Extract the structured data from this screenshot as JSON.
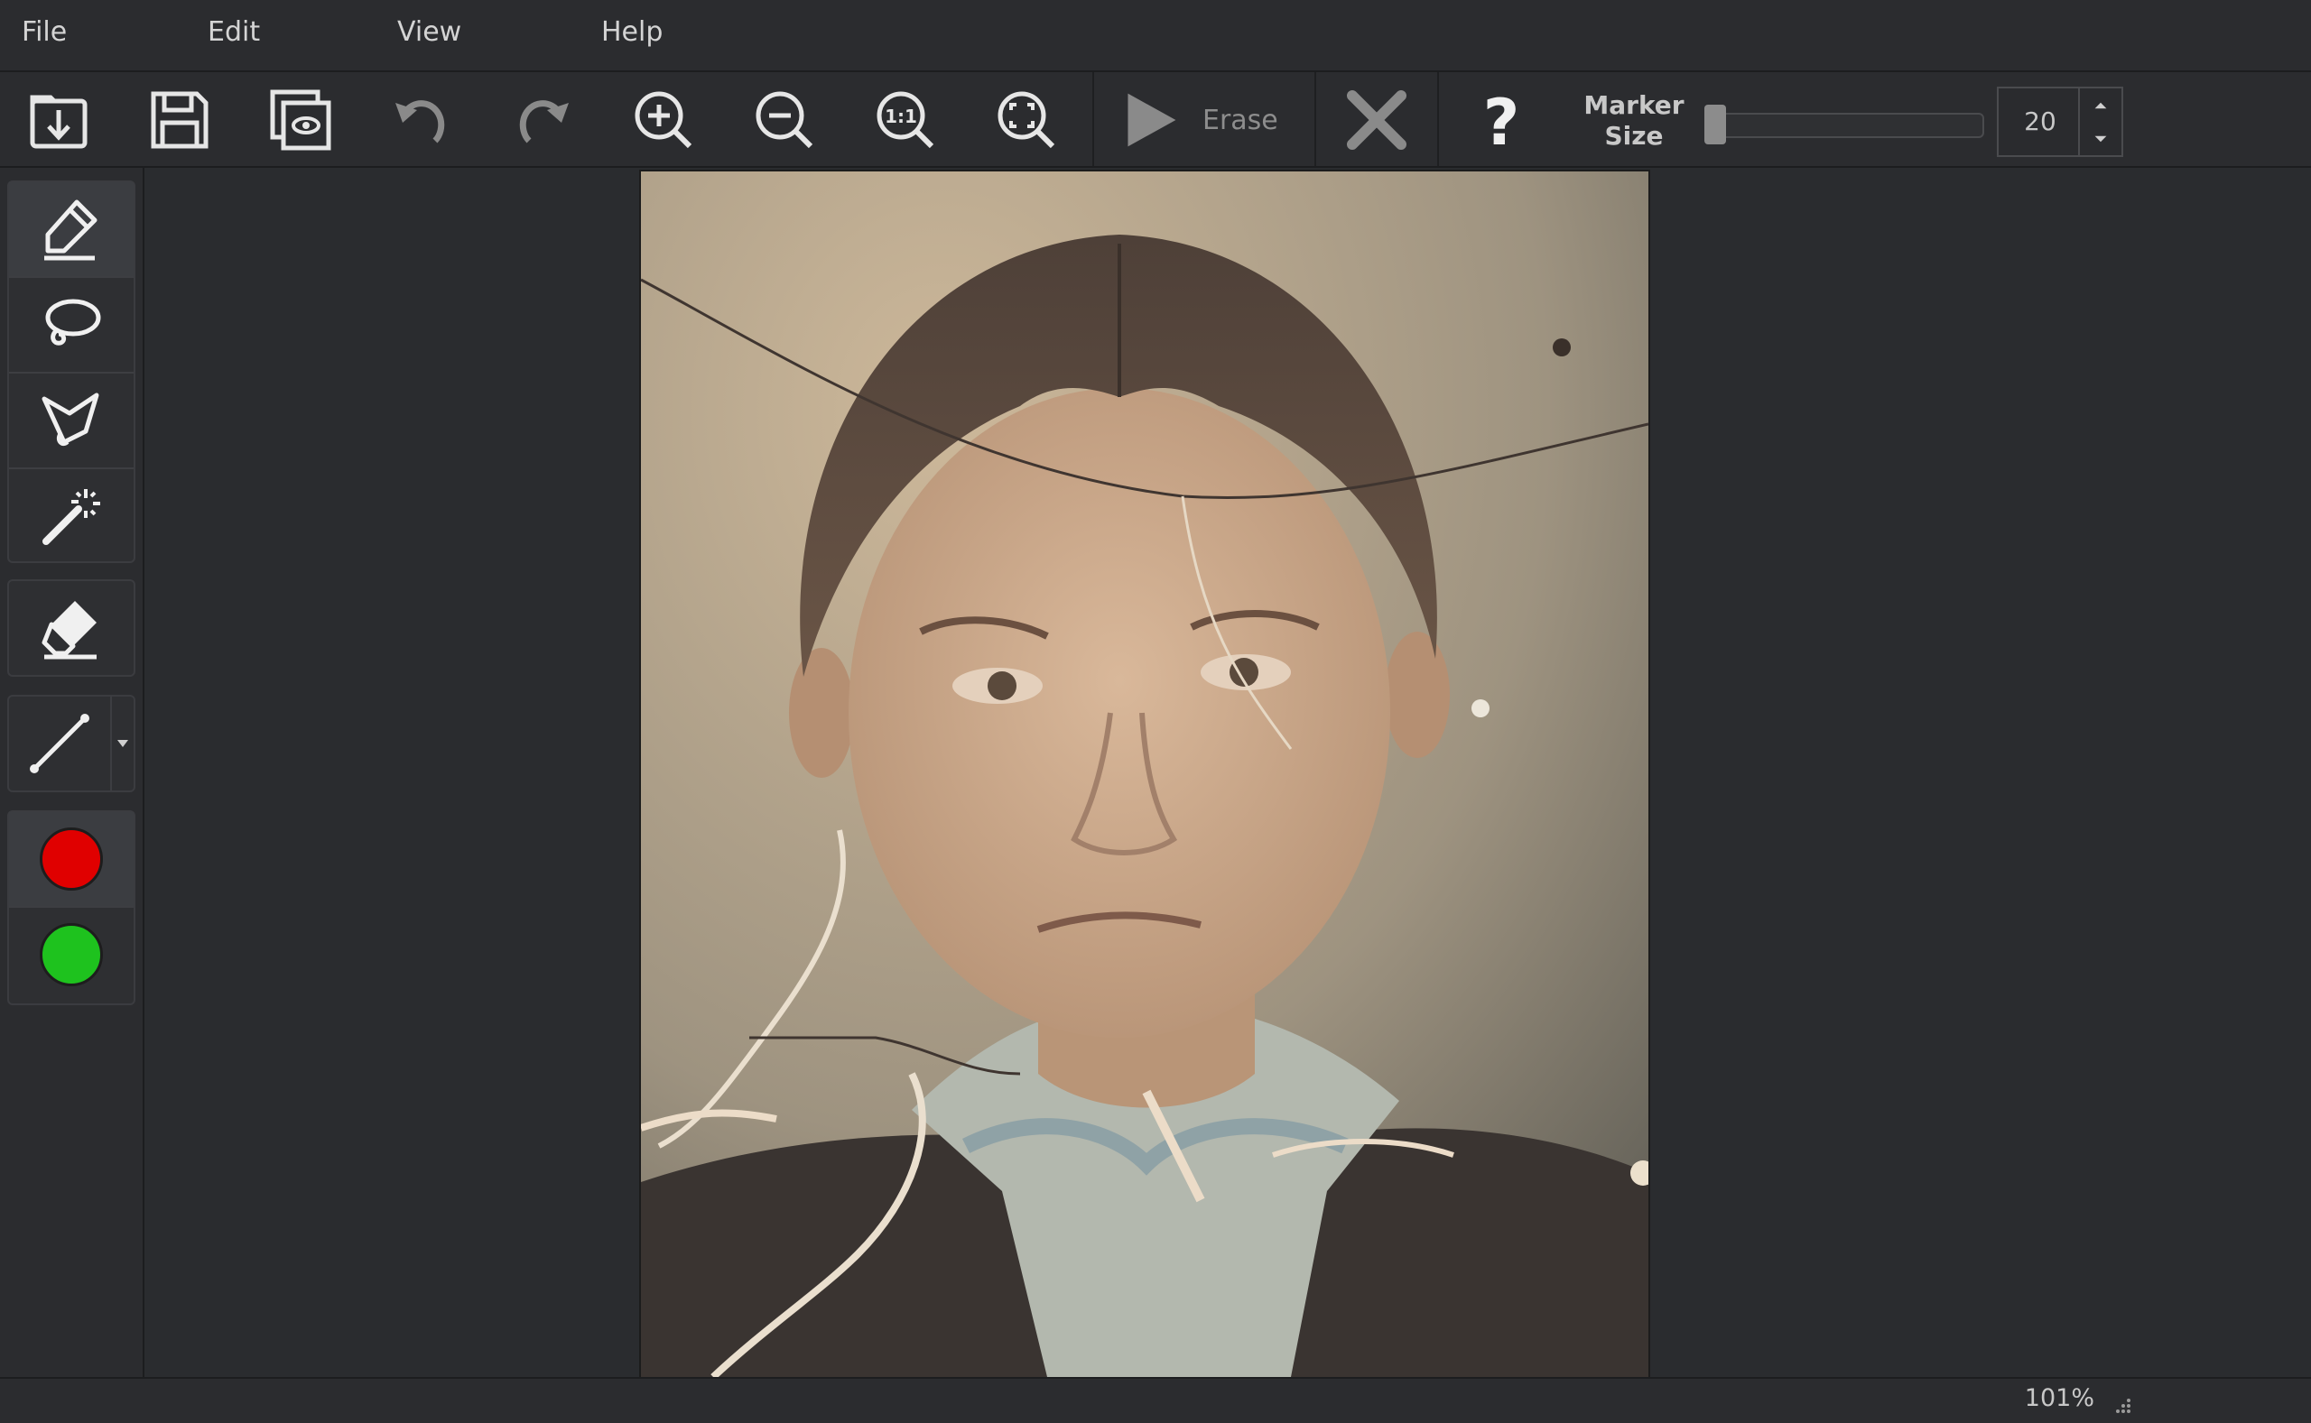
{
  "menu": [
    {
      "label": "File"
    },
    {
      "label": "Edit"
    },
    {
      "label": "View"
    },
    {
      "label": "Help"
    }
  ],
  "toolbar": {
    "icons": [
      "open-icon",
      "save-icon",
      "preview-icon",
      "undo-icon",
      "redo-icon",
      "zoom-in-icon",
      "zoom-out-icon",
      "zoom-actual-icon",
      "zoom-fit-icon",
      "play-icon",
      "cancel-icon",
      "help-icon"
    ],
    "erase_label": "Erase",
    "marker_size_label_line1": "Marker",
    "marker_size_label_line2": "Size",
    "marker_size_value": "20",
    "marker_size_level": 0.02
  },
  "tools": {
    "icons": [
      "marker-icon",
      "lasso-icon",
      "polygon-lasso-icon",
      "magic-wand-icon",
      "eraser-icon",
      "line-icon"
    ],
    "colors": {
      "red": "#e00000",
      "green": "#1ec21e"
    }
  },
  "status": {
    "zoom": "101%"
  }
}
